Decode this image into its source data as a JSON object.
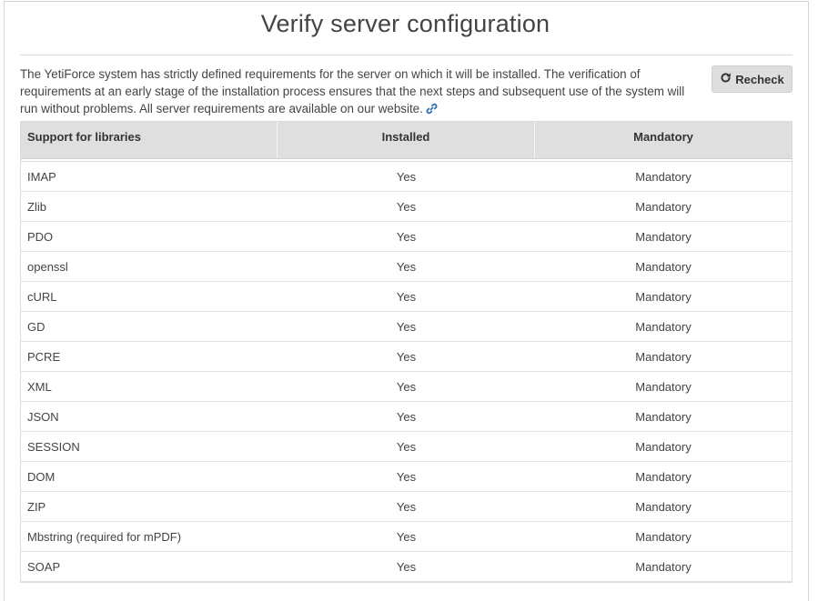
{
  "page": {
    "title": "Verify server configuration"
  },
  "intro": {
    "text": "The YetiForce system has strictly defined requirements for the server on which it will be installed. The verification of requirements at an early stage of the installation process ensures that the next steps and subsequent use of the system will run without problems. All server requirements are available on our website.",
    "link_icon": "link-icon"
  },
  "toolbar": {
    "recheck_label": "Recheck",
    "recheck_icon": "redo-icon"
  },
  "table": {
    "headers": {
      "library": "Support for libraries",
      "installed": "Installed",
      "mandatory": "Mandatory"
    },
    "rows": [
      {
        "library": "IMAP",
        "installed": "Yes",
        "mandatory": "Mandatory"
      },
      {
        "library": "Zlib",
        "installed": "Yes",
        "mandatory": "Mandatory"
      },
      {
        "library": "PDO",
        "installed": "Yes",
        "mandatory": "Mandatory"
      },
      {
        "library": "openssl",
        "installed": "Yes",
        "mandatory": "Mandatory"
      },
      {
        "library": "cURL",
        "installed": "Yes",
        "mandatory": "Mandatory"
      },
      {
        "library": "GD",
        "installed": "Yes",
        "mandatory": "Mandatory"
      },
      {
        "library": "PCRE",
        "installed": "Yes",
        "mandatory": "Mandatory"
      },
      {
        "library": "XML",
        "installed": "Yes",
        "mandatory": "Mandatory"
      },
      {
        "library": "JSON",
        "installed": "Yes",
        "mandatory": "Mandatory"
      },
      {
        "library": "SESSION",
        "installed": "Yes",
        "mandatory": "Mandatory"
      },
      {
        "library": "DOM",
        "installed": "Yes",
        "mandatory": "Mandatory"
      },
      {
        "library": "ZIP",
        "installed": "Yes",
        "mandatory": "Mandatory"
      },
      {
        "library": "Mbstring (required for mPDF)",
        "installed": "Yes",
        "mandatory": "Mandatory"
      },
      {
        "library": "SOAP",
        "installed": "Yes",
        "mandatory": "Mandatory"
      }
    ]
  },
  "colors": {
    "link": "#2f6fb5",
    "header_bg": "#dfdfdf",
    "button_bg": "#dedede"
  }
}
